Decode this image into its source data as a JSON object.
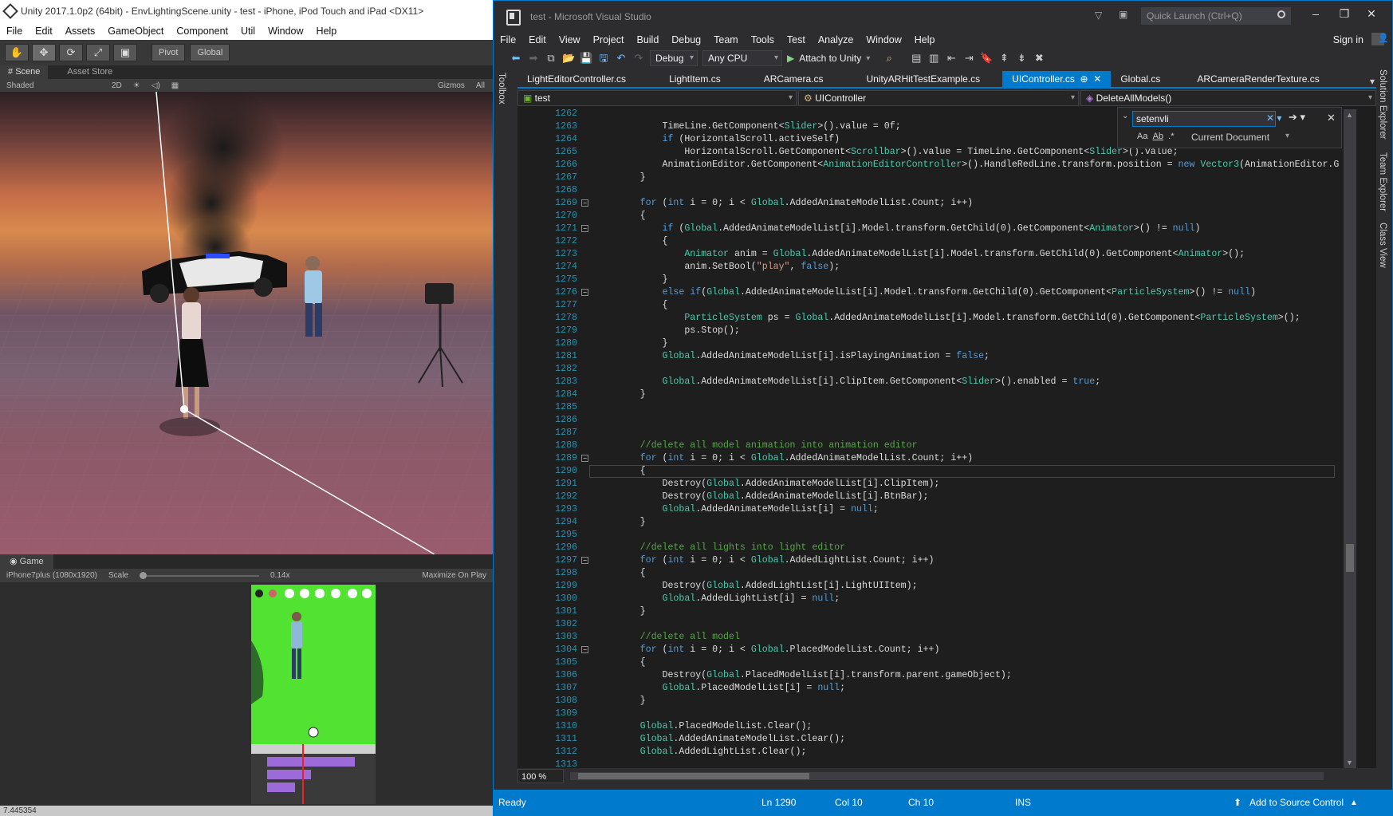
{
  "unity": {
    "title": "Unity 2017.1.0p2 (64bit) - EnvLightingScene.unity - test - iPhone, iPod Touch and iPad <DX11>",
    "menu": [
      "File",
      "Edit",
      "Assets",
      "GameObject",
      "Component",
      "Util",
      "Window",
      "Help"
    ],
    "toolbar": {
      "pivot": "Pivot",
      "global": "Global"
    },
    "tabs": {
      "scene": "Scene",
      "asset_store": "Asset Store"
    },
    "scenebar": {
      "shading": "Shaded",
      "mode_2d": "2D",
      "gizmos": "Gizmos",
      "search": "All"
    },
    "game": {
      "tab": "Game",
      "resolution": "iPhone7plus (1080x1920)",
      "scale_label": "Scale",
      "scale_value": "0.14x",
      "maximize": "Maximize On Play"
    },
    "status": "7.445354"
  },
  "vs": {
    "title": "test - Microsoft Visual Studio",
    "quick_launch": "Quick Launch (Ctrl+Q)",
    "menu": [
      "File",
      "Edit",
      "View",
      "Project",
      "Build",
      "Debug",
      "Team",
      "Tools",
      "Test",
      "Analyze",
      "Window",
      "Help"
    ],
    "sign_in": "Sign in",
    "toolbar": {
      "config": "Debug",
      "platform": "Any CPU",
      "attach": "Attach to Unity"
    },
    "left_panel": "Toolbox",
    "right_panels": [
      "Solution Explorer",
      "Team Explorer",
      "Class View"
    ],
    "tabs": [
      "LightEditorController.cs",
      "LightItem.cs",
      "ARCamera.cs",
      "UnityARHitTestExample.cs",
      "UIController.cs",
      "Global.cs",
      "ARCameraRenderTexture.cs"
    ],
    "active_tab": "UIController.cs",
    "nav": {
      "project": "test",
      "class": "UIController",
      "member": "DeleteAllModels()"
    },
    "find": {
      "query": "setenvli",
      "scope": "Current Document"
    },
    "zoom": "100 %",
    "status": {
      "ready": "Ready",
      "ln": "Ln 1290",
      "col": "Col 10",
      "ch": "Ch 10",
      "ins": "INS",
      "source_control": "Add to Source Control"
    },
    "code": [
      {
        "n": "1262",
        "t": ""
      },
      {
        "n": "1263",
        "t": "            TimeLine.GetComponent<Slider>().value = 0f;"
      },
      {
        "n": "1264",
        "t": "            if (HorizontalScroll.activeSelf)"
      },
      {
        "n": "1265",
        "t": "                HorizontalScroll.GetComponent<Scrollbar>().value = TimeLine.GetComponent<Slider>().value;"
      },
      {
        "n": "1266",
        "t": "            AnimationEditor.GetComponent<AnimationEditorController>().HandleRedLine.transform.position = new Vector3(AnimationEditor.G"
      },
      {
        "n": "1267",
        "t": "        }"
      },
      {
        "n": "1268",
        "t": ""
      },
      {
        "n": "1269",
        "t": "        for (int i = 0; i < Global.AddedAnimateModelList.Count; i++)"
      },
      {
        "n": "1270",
        "t": "        {"
      },
      {
        "n": "1271",
        "t": "            if (Global.AddedAnimateModelList[i].Model.transform.GetChild(0).GetComponent<Animator>() != null)"
      },
      {
        "n": "1272",
        "t": "            {"
      },
      {
        "n": "1273",
        "t": "                Animator anim = Global.AddedAnimateModelList[i].Model.transform.GetChild(0).GetComponent<Animator>();"
      },
      {
        "n": "1274",
        "t": "                anim.SetBool(\"play\", false);"
      },
      {
        "n": "1275",
        "t": "            }"
      },
      {
        "n": "1276",
        "t": "            else if(Global.AddedAnimateModelList[i].Model.transform.GetChild(0).GetComponent<ParticleSystem>() != null)"
      },
      {
        "n": "1277",
        "t": "            {"
      },
      {
        "n": "1278",
        "t": "                ParticleSystem ps = Global.AddedAnimateModelList[i].Model.transform.GetChild(0).GetComponent<ParticleSystem>();"
      },
      {
        "n": "1279",
        "t": "                ps.Stop();"
      },
      {
        "n": "1280",
        "t": "            }"
      },
      {
        "n": "1281",
        "t": "            Global.AddedAnimateModelList[i].isPlayingAnimation = false;"
      },
      {
        "n": "1282",
        "t": ""
      },
      {
        "n": "1283",
        "t": "            Global.AddedAnimateModelList[i].ClipItem.GetComponent<Slider>().enabled = true;"
      },
      {
        "n": "1284",
        "t": "        }"
      },
      {
        "n": "1285",
        "t": ""
      },
      {
        "n": "1286",
        "t": ""
      },
      {
        "n": "1287",
        "t": ""
      },
      {
        "n": "1288",
        "t": "        //delete all model animation into animation editor"
      },
      {
        "n": "1289",
        "t": "        for (int i = 0; i < Global.AddedAnimateModelList.Count; i++)"
      },
      {
        "n": "1290",
        "t": "        {"
      },
      {
        "n": "1291",
        "t": "            Destroy(Global.AddedAnimateModelList[i].ClipItem);"
      },
      {
        "n": "1292",
        "t": "            Destroy(Global.AddedAnimateModelList[i].BtnBar);"
      },
      {
        "n": "1293",
        "t": "            Global.AddedAnimateModelList[i] = null;"
      },
      {
        "n": "1294",
        "t": "        }"
      },
      {
        "n": "1295",
        "t": ""
      },
      {
        "n": "1296",
        "t": "        //delete all lights into light editor"
      },
      {
        "n": "1297",
        "t": "        for (int i = 0; i < Global.AddedLightList.Count; i++)"
      },
      {
        "n": "1298",
        "t": "        {"
      },
      {
        "n": "1299",
        "t": "            Destroy(Global.AddedLightList[i].LightUIItem);"
      },
      {
        "n": "1300",
        "t": "            Global.AddedLightList[i] = null;"
      },
      {
        "n": "1301",
        "t": "        }"
      },
      {
        "n": "1302",
        "t": ""
      },
      {
        "n": "1303",
        "t": "        //delete all model"
      },
      {
        "n": "1304",
        "t": "        for (int i = 0; i < Global.PlacedModelList.Count; i++)"
      },
      {
        "n": "1305",
        "t": "        {"
      },
      {
        "n": "1306",
        "t": "            Destroy(Global.PlacedModelList[i].transform.parent.gameObject);"
      },
      {
        "n": "1307",
        "t": "            Global.PlacedModelList[i] = null;"
      },
      {
        "n": "1308",
        "t": "        }"
      },
      {
        "n": "1309",
        "t": ""
      },
      {
        "n": "1310",
        "t": "        Global.PlacedModelList.Clear();"
      },
      {
        "n": "1311",
        "t": "        Global.AddedAnimateModelList.Clear();"
      },
      {
        "n": "1312",
        "t": "        Global.AddedLightList.Clear();"
      },
      {
        "n": "1313",
        "t": ""
      }
    ],
    "colors": {
      "accent": "#007acc",
      "keyword": "#569cd6",
      "type": "#4ec9b0",
      "string": "#d69d85",
      "comment": "#57a64a",
      "line_number": "#2b91af"
    }
  }
}
